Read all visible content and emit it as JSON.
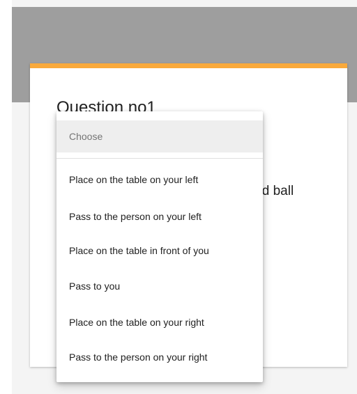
{
  "question": {
    "title": "Question no1",
    "text_visible": "e red ball"
  },
  "dropdown": {
    "placeholder": "Choose",
    "options": [
      "Place on the table on your left",
      "Pass to the person on your left",
      "Place on the table in front of you",
      "Pass to you",
      "Place on the table on your right",
      "Pass to the person on your right"
    ]
  },
  "colors": {
    "accent": "#f9a93b",
    "header_band": "#9e9e9e",
    "page_background": "#f4f4f4"
  }
}
